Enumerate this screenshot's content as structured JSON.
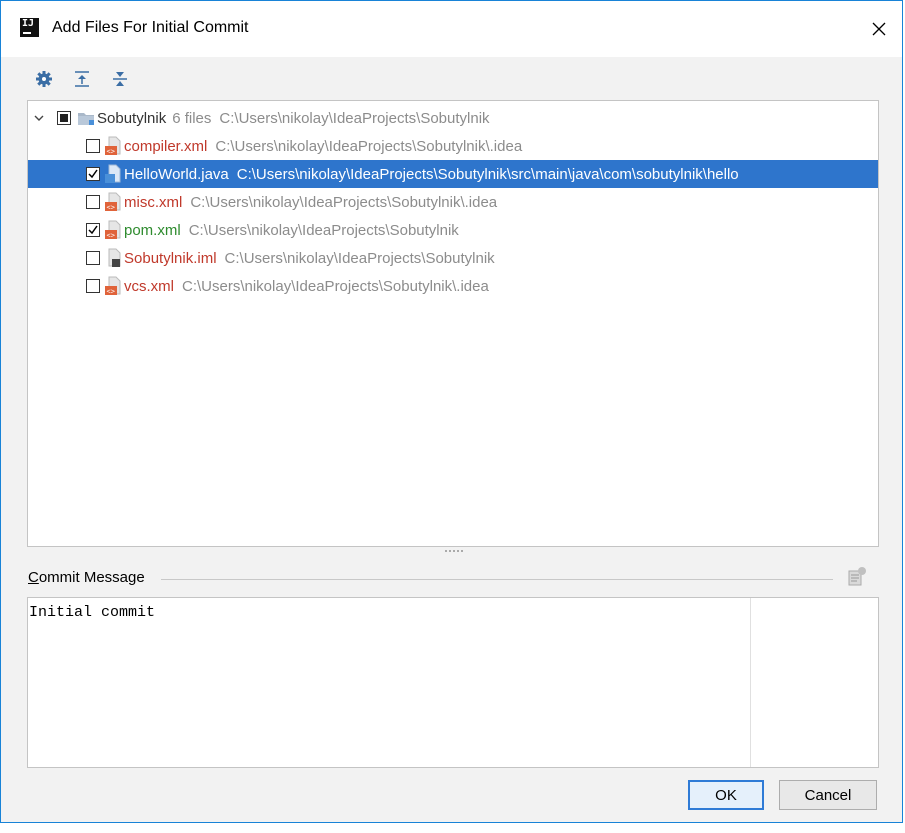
{
  "window": {
    "title": "Add Files For Initial Commit",
    "app_icon_text": "IJ"
  },
  "toolbar": {
    "buttons": [
      {
        "icon": "gear-icon"
      },
      {
        "icon": "expand-all-icon"
      },
      {
        "icon": "collapse-all-icon"
      }
    ]
  },
  "tree": {
    "root": {
      "name": "Sobutylnik",
      "count": "6 files",
      "path": "C:\\Users\\nikolay\\IdeaProjects\\Sobutylnik",
      "checked": "partial"
    },
    "files": [
      {
        "name": "compiler.xml",
        "path": "C:\\Users\\nikolay\\IdeaProjects\\Sobutylnik\\.idea",
        "checked": false,
        "color": "#c0392b",
        "type": "xml"
      },
      {
        "name": "HelloWorld.java",
        "path": "C:\\Users\\nikolay\\IdeaProjects\\Sobutylnik\\src\\main\\java\\com\\sobutylnik\\hello",
        "checked": true,
        "selected": true,
        "color": "#ffffff",
        "type": "java"
      },
      {
        "name": "misc.xml",
        "path": "C:\\Users\\nikolay\\IdeaProjects\\Sobutylnik\\.idea",
        "checked": false,
        "color": "#c0392b",
        "type": "xml"
      },
      {
        "name": "pom.xml",
        "path": "C:\\Users\\nikolay\\IdeaProjects\\Sobutylnik",
        "checked": true,
        "color": "#2e8b2e",
        "type": "xml"
      },
      {
        "name": "Sobutylnik.iml",
        "path": "C:\\Users\\nikolay\\IdeaProjects\\Sobutylnik",
        "checked": false,
        "color": "#c0392b",
        "type": "iml"
      },
      {
        "name": "vcs.xml",
        "path": "C:\\Users\\nikolay\\IdeaProjects\\Sobutylnik\\.idea",
        "checked": false,
        "color": "#c0392b",
        "type": "xml"
      }
    ]
  },
  "commit": {
    "label_mnemonic": "C",
    "label_rest": "ommit Message",
    "message": "Initial commit"
  },
  "buttons": {
    "ok": "OK",
    "cancel": "Cancel"
  },
  "colors": {
    "selection": "#2e75cc",
    "unversioned": "#c0392b",
    "added": "#2e8b2e",
    "accent": "#2f7bd6"
  }
}
